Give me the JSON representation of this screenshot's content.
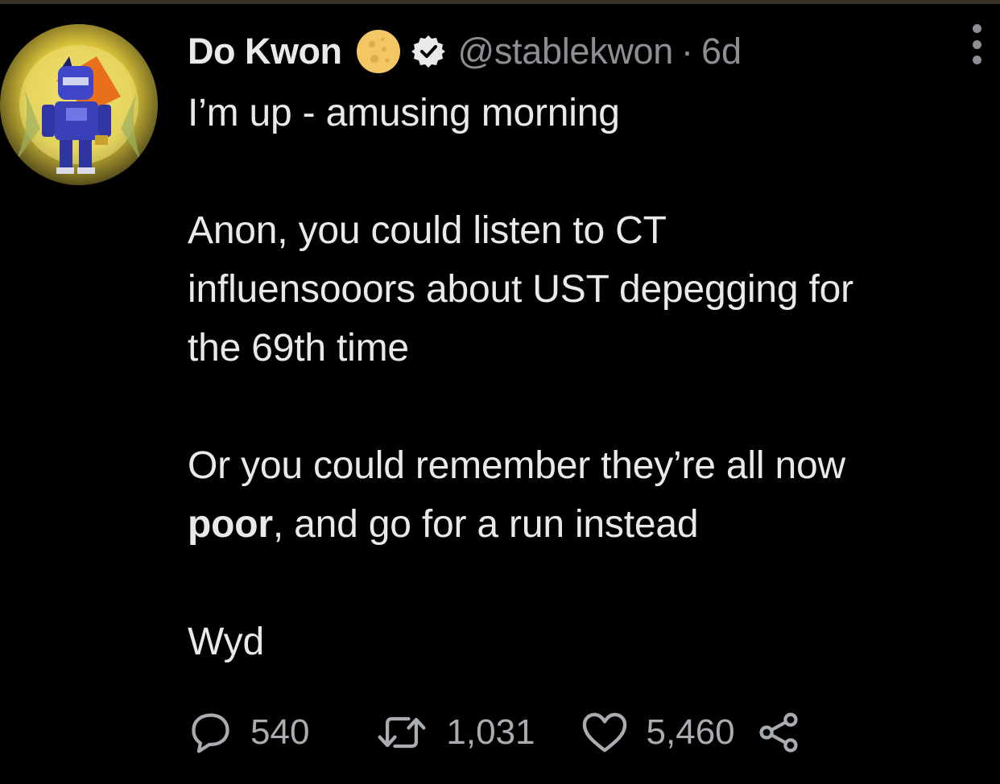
{
  "tweet": {
    "display_name": "Do Kwon",
    "handle": "@stablekwon",
    "separator": "·",
    "time_ago": "6d",
    "line1": "I’m up - amusing morning",
    "p2_l1": "Anon, you could listen to CT",
    "p2_l2": "influensooors about UST depegging for",
    "p2_l3": "the 69th time",
    "p3_l1": "Or you could remember they’re all now",
    "p3_bold": "poor",
    "p3_rest": ", and go for a run instead",
    "p4": "Wyd"
  },
  "actions": {
    "replies": "540",
    "retweets": "1,031",
    "likes": "5,460"
  },
  "icons": {
    "avatar": "armored-robot-avatar",
    "name_emoji": "full-moon-emoji",
    "badge": "verified-badge",
    "more": "more-options-icon",
    "reply": "reply-icon",
    "retweet": "retweet-icon",
    "like": "heart-icon",
    "share": "share-icon"
  },
  "colors": {
    "background": "#000000",
    "text": "#e7e9ea",
    "secondary": "#8b8f94",
    "moon": "#f3c766"
  }
}
